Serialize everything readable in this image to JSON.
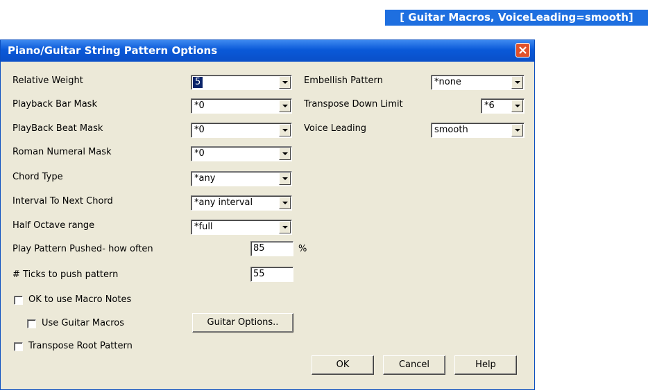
{
  "banner": {
    "text": "[ Guitar Macros, VoiceLeading=smooth]"
  },
  "dialog": {
    "title": "Piano/Guitar String Pattern Options",
    "left": {
      "relative_weight": {
        "label": "Relative Weight",
        "value": "5"
      },
      "playback_bar_mask": {
        "label": "Playback Bar Mask",
        "value": "*0"
      },
      "playback_beat_mask": {
        "label": "PlayBack Beat Mask",
        "value": "*0"
      },
      "roman_numeral_mask": {
        "label": "Roman Numeral Mask",
        "value": "*0"
      },
      "chord_type": {
        "label": "Chord Type",
        "value": "*any"
      },
      "interval_next_chord": {
        "label": "Interval To Next Chord",
        "value": "*any interval"
      },
      "half_octave_range": {
        "label": "Half Octave range",
        "value": "*full"
      },
      "play_pattern_pushed": {
        "label": "Play Pattern Pushed- how often",
        "value": "85",
        "unit": "%"
      },
      "ticks_to_push": {
        "label": "# Ticks to push pattern",
        "value": "55"
      },
      "ok_macro_notes": {
        "label": "OK to use Macro Notes",
        "checked": false
      },
      "use_guitar_macros": {
        "label": "Use Guitar Macros",
        "checked": false
      },
      "guitar_options_button": "Guitar Options..",
      "transpose_root_pattern": {
        "label": "Transpose Root Pattern",
        "checked": false
      }
    },
    "right": {
      "embellish_pattern": {
        "label": "Embellish Pattern",
        "value": "*none"
      },
      "transpose_down_limit": {
        "label": "Transpose Down Limit",
        "value": "*6"
      },
      "voice_leading": {
        "label": "Voice Leading",
        "value": "smooth"
      }
    },
    "buttons": {
      "ok": "OK",
      "cancel": "Cancel",
      "help": "Help"
    }
  }
}
